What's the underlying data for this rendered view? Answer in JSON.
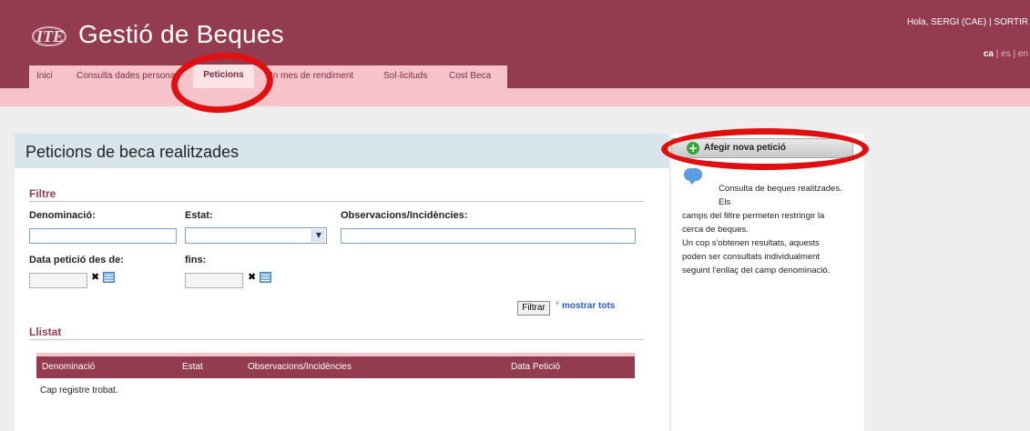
{
  "header": {
    "app_title": "Gestió de Beques",
    "user_greeting": "Hola, SERGI  (CAE)  |  SORTIR",
    "languages": {
      "active": "ca",
      "others": "es | en"
    }
  },
  "tabs": [
    {
      "label": "Inici"
    },
    {
      "label": "Consulta dades persona"
    },
    {
      "label": "Peticions"
    },
    {
      "label": "In      mes de rendiment"
    },
    {
      "label": "Sol·licituds"
    },
    {
      "label": "Cost Beca"
    }
  ],
  "main": {
    "title": "Peticions de beca realitzades",
    "filter": {
      "section_title": "Filtre",
      "denominacio_label": "Denominació:",
      "estat_label": "Estat:",
      "observacions_label": "Observacions/Incidències:",
      "data_des_label": "Data petició des de:",
      "fins_label": "fins:",
      "filter_button": "Filtrar",
      "show_all_link": "mostrar tots"
    },
    "list": {
      "section_title": "Llistat",
      "columns": [
        "Denominació",
        "Estat",
        "Observacions/Incidències",
        "Data Petició"
      ],
      "empty_message": "Cap registre trobat."
    }
  },
  "sidebar": {
    "add_button": "Afegir nova petició",
    "help_lines": [
      "Consulta de beques realitzades. Els",
      "camps del filtre permeten restringir la",
      "cerca de beques.",
      "Un cop s'obtenen resultats, aquests",
      "poden ser consultats individualment",
      "seguint l'enllaç del camp denominació."
    ]
  },
  "colors": {
    "header": "#933c4f",
    "accent_pink": "#f7c3cb",
    "annotation_ring": "#e01010",
    "link": "#2a5ec9"
  },
  "icons": [
    "logo-icon",
    "clear-date-icon",
    "calendar-icon",
    "add-icon",
    "info-bubble-icon",
    "dropdown-arrow-icon"
  ]
}
